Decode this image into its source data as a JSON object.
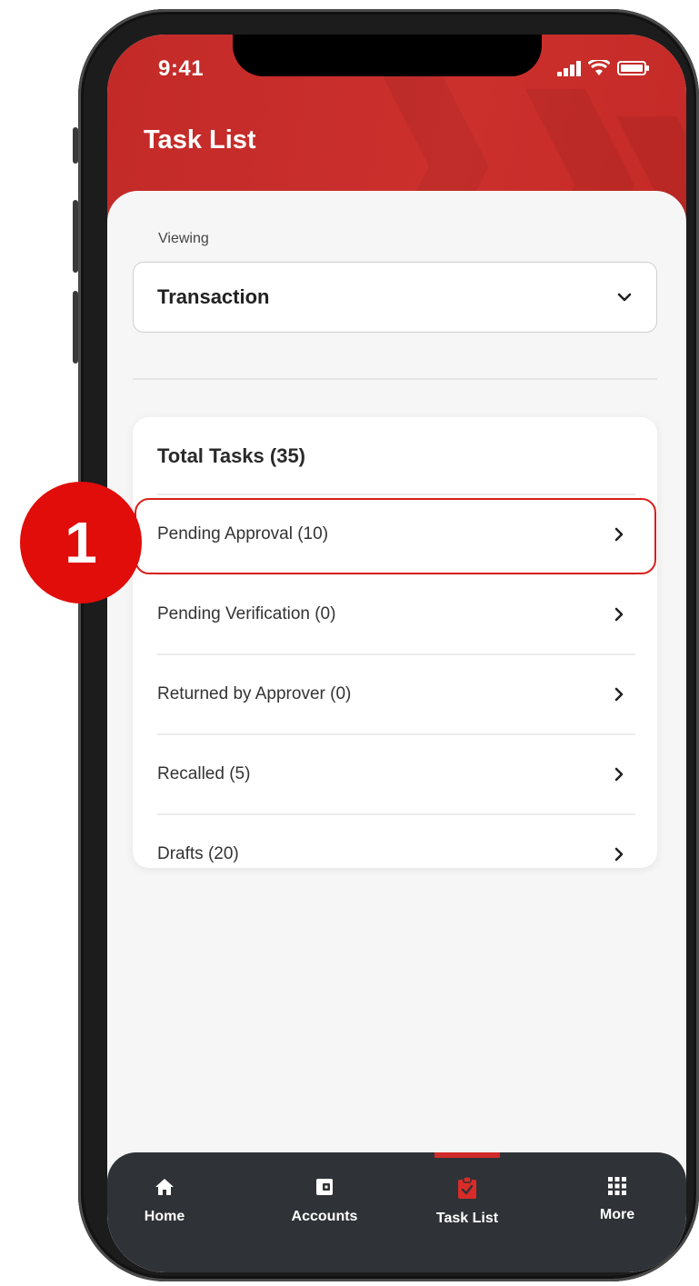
{
  "status_bar": {
    "time": "9:41"
  },
  "header": {
    "title": "Task List"
  },
  "viewing": {
    "label": "Viewing",
    "selected": "Transaction"
  },
  "tasks": {
    "title": "Total Tasks (35)",
    "items": [
      {
        "label": "Pending Approval (10)"
      },
      {
        "label": "Pending Verification (0)"
      },
      {
        "label": "Returned by Approver (0)"
      },
      {
        "label": "Recalled (5)"
      },
      {
        "label": "Drafts (20)"
      }
    ]
  },
  "annotation": {
    "step": "1"
  },
  "tab_bar": {
    "items": [
      {
        "label": "Home",
        "icon": "home-icon"
      },
      {
        "label": "Accounts",
        "icon": "wallet-icon"
      },
      {
        "label": "Task List",
        "icon": "clipboard-check-icon",
        "active": true
      },
      {
        "label": "More",
        "icon": "grid-icon"
      }
    ]
  },
  "colors": {
    "brand_red": "#c8302c",
    "highlight": "#d9201b",
    "badge": "#e00d0a",
    "tabbar": "#2f3236"
  }
}
